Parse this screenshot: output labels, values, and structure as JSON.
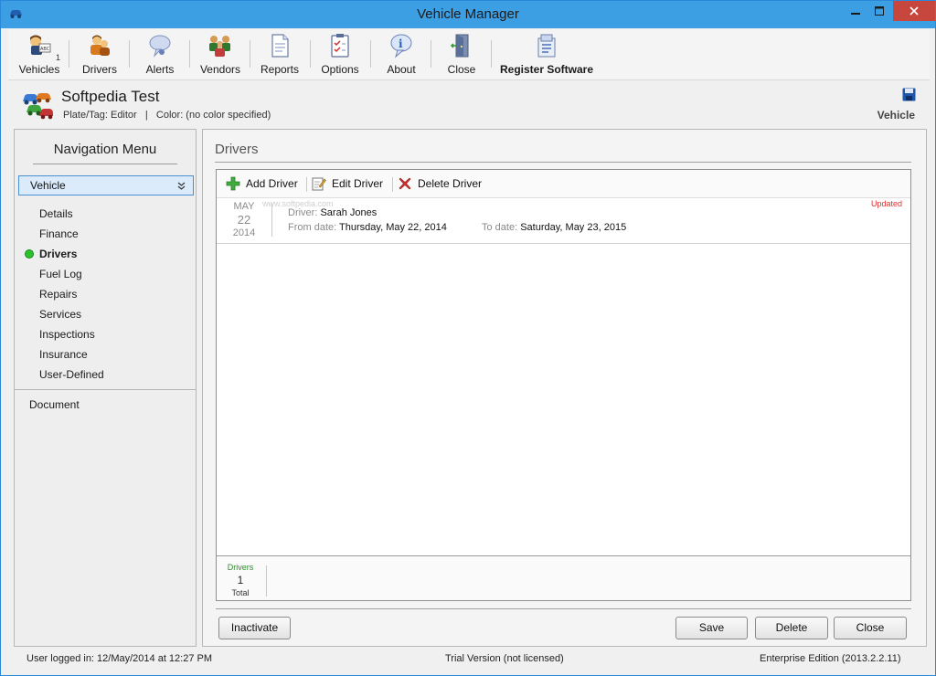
{
  "window": {
    "title": "Vehicle Manager"
  },
  "toolbar": {
    "items": [
      {
        "label": "Vehicles",
        "badge": "1",
        "icon": "vehicles-icon"
      },
      {
        "label": "Drivers",
        "icon": "drivers-icon"
      },
      {
        "label": "Alerts",
        "icon": "alerts-icon"
      },
      {
        "label": "Vendors",
        "icon": "vendors-icon"
      },
      {
        "label": "Reports",
        "icon": "reports-icon"
      },
      {
        "label": "Options",
        "icon": "options-icon"
      },
      {
        "label": "About",
        "icon": "about-icon"
      },
      {
        "label": "Close",
        "icon": "close-door-icon"
      },
      {
        "label": "Register Software",
        "icon": "register-icon"
      }
    ]
  },
  "vehicle": {
    "name": "Softpedia Test",
    "meta": "Plate/Tag: Editor   |   Color: (no color specified)",
    "section_label": "Vehicle"
  },
  "nav": {
    "title": "Navigation Menu",
    "selected_group": "Vehicle",
    "items": [
      "Details",
      "Finance",
      "Drivers",
      "Fuel Log",
      "Repairs",
      "Services",
      "Inspections",
      "Insurance",
      "User-Defined"
    ],
    "active_item": "Drivers",
    "document": "Document"
  },
  "main": {
    "title": "Drivers",
    "actions": {
      "add": "Add Driver",
      "edit": "Edit Driver",
      "delete": "Delete Driver"
    },
    "watermark": "www.softpedia.com",
    "records": [
      {
        "month": "MAY",
        "day": "22",
        "year": "2014",
        "driver_key": "Driver:",
        "driver": "Sarah Jones",
        "from_key": "From date:",
        "from": "Thursday, May 22, 2014",
        "to_key": "To date:",
        "to": "Saturday, May 23, 2015",
        "status": "Updated"
      }
    ],
    "summary": {
      "label": "Drivers",
      "count": "1",
      "total_label": "Total"
    },
    "buttons": {
      "inactivate": "Inactivate",
      "save": "Save",
      "delete": "Delete",
      "close": "Close"
    }
  },
  "status": {
    "user": "User logged in:  12/May/2014 at 12:27 PM",
    "license": "Trial Version (not licensed)",
    "edition": "Enterprise Edition (2013.2.2.11)"
  },
  "colors": {
    "title_bar": "#3d9fe3",
    "close_button": "#c7463d",
    "active_dot": "#2ec12e",
    "updated_text": "#e03030"
  }
}
